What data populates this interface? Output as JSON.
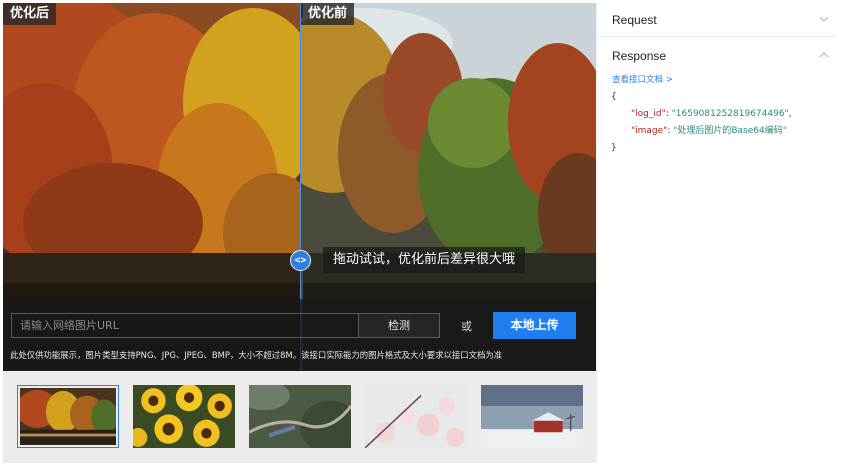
{
  "demo": {
    "label_after": "优化后",
    "label_before": "优化前",
    "handle_glyph": "<>",
    "hint": "拖动试试，优化前后差异很大哦",
    "url_placeholder": "请输入网络图片URL",
    "detect_label": "检测",
    "or_label": "或",
    "upload_label": "本地上传",
    "notice": "此处仅供功能展示，图片类型支持PNG、JPG、JPEG、BMP，大小不超过8M。该接口实际能力的图片格式及大小要求以接口文档为准"
  },
  "thumbnails": [
    {
      "name": "autumn-forest",
      "active": true
    },
    {
      "name": "sunflowers",
      "active": false
    },
    {
      "name": "mountain-train",
      "active": false
    },
    {
      "name": "blossoms",
      "active": false
    },
    {
      "name": "snow-barn",
      "active": false
    }
  ],
  "panel": {
    "request_label": "Request",
    "response_label": "Response",
    "doc_link": "查看接口文档 >",
    "code": {
      "open": "{",
      "close": "}",
      "log_id_key": "\"log_id\"",
      "log_id_value": "\"1659081252819674496\"",
      "image_key": "\"image\"",
      "image_value": "\"处理后图片的Base64编码\""
    }
  },
  "colors": {
    "accent": "#1f7ef0",
    "key": "#b02020",
    "value": "#2a8c7a"
  }
}
